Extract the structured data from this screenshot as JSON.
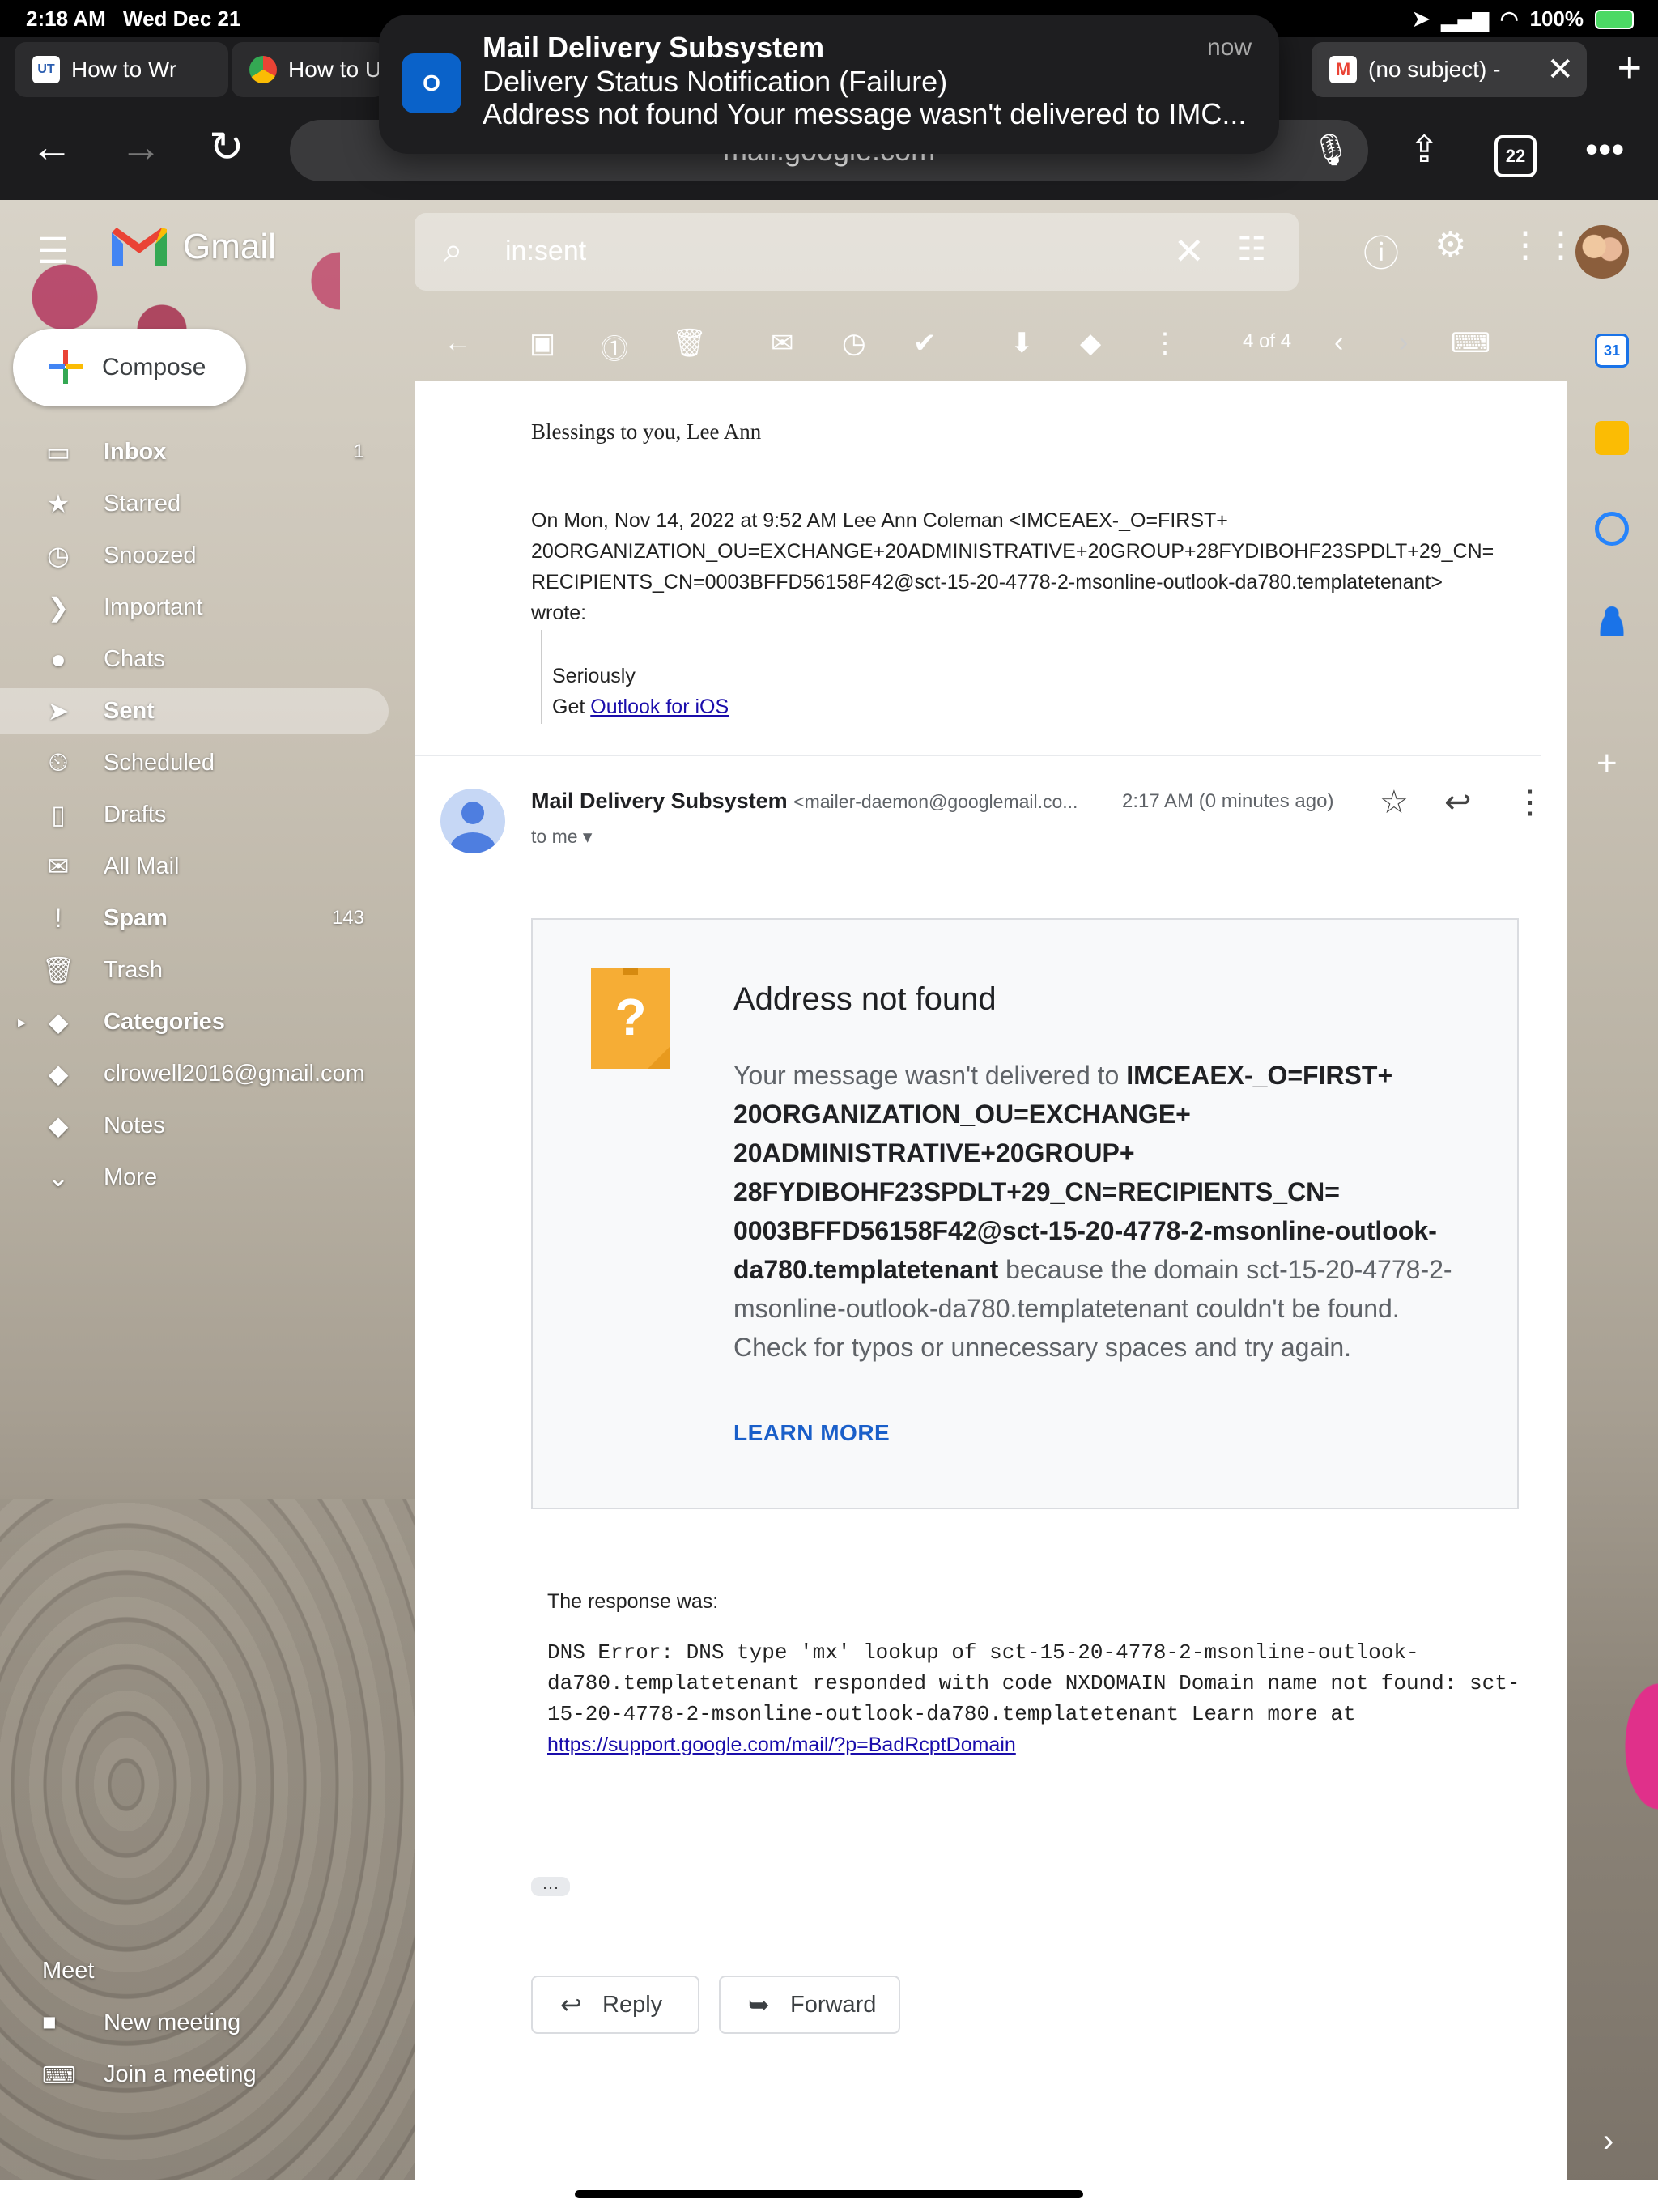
{
  "status_bar": {
    "time": "2:18 AM",
    "date": "Wed Dec 21",
    "battery": "100%"
  },
  "tabs": [
    {
      "label": "How to Wr",
      "favicon": "UT"
    },
    {
      "label": "How to U",
      "favicon": "chrome"
    },
    {
      "label": "(no subject) - ",
      "favicon": "gmail"
    }
  ],
  "toolbar": {
    "url": "mail.google.com",
    "tab_count": "22"
  },
  "notification": {
    "app": "Outlook",
    "title": "Mail Delivery Subsystem",
    "subtitle": "Delivery Status Notification (Failure)",
    "body": "Address not found Your message wasn't delivered to IMC...",
    "when": "now"
  },
  "gmail": {
    "brand": "Gmail",
    "search_query": "in:sent"
  },
  "compose": {
    "label": "Compose"
  },
  "sidebar": {
    "items": [
      {
        "label": "Inbox",
        "icon": "inbox-icon",
        "count": "1",
        "bold": true
      },
      {
        "label": "Starred",
        "icon": "star-icon",
        "count": ""
      },
      {
        "label": "Snoozed",
        "icon": "clock-icon",
        "count": ""
      },
      {
        "label": "Important",
        "icon": "important-icon",
        "count": ""
      },
      {
        "label": "Chats",
        "icon": "chat-icon",
        "count": ""
      },
      {
        "label": "Sent",
        "icon": "send-icon",
        "count": "",
        "bold": true,
        "active": true
      },
      {
        "label": "Scheduled",
        "icon": "scheduled-icon",
        "count": ""
      },
      {
        "label": "Drafts",
        "icon": "draft-icon",
        "count": ""
      },
      {
        "label": "All Mail",
        "icon": "mail-icon",
        "count": ""
      },
      {
        "label": "Spam",
        "icon": "spam-icon",
        "count": "143",
        "bold": true
      },
      {
        "label": "Trash",
        "icon": "trash-icon",
        "count": ""
      },
      {
        "label": "Categories",
        "icon": "label-icon",
        "count": "",
        "bold": true
      },
      {
        "label": "clrowell2016@gmail.com",
        "icon": "label-icon",
        "count": ""
      },
      {
        "label": "Notes",
        "icon": "label-icon",
        "count": ""
      },
      {
        "label": "More",
        "icon": "chevron-down-icon",
        "count": ""
      }
    ],
    "meet": {
      "heading": "Meet",
      "new_meeting": "New meeting",
      "join_meeting": "Join a meeting"
    }
  },
  "action_bar": {
    "pager": "4 of 4"
  },
  "thread": {
    "signoff": "Blessings to you, Lee Ann",
    "quote_header_1": "On Mon, Nov 14, 2022 at 9:52 AM Lee Ann Coleman <IMCEAEX-_O=FIRST+",
    "quote_header_2": "20ORGANIZATION_OU=EXCHANGE+20ADMINISTRATIVE+20GROUP+28FYDIBOHF23SPDLT+29_CN=",
    "quote_header_3": "RECIPIENTS_CN=0003BFFD56158F42@sct-15-20-4778-2-msonline-outlook-da780.templatetenant>",
    "quote_header_4": "wrote:",
    "quoted_line_1": "Seriously",
    "quoted_get": "Get ",
    "quoted_link": "Outlook for iOS"
  },
  "message": {
    "sender_name": "Mail Delivery Subsystem",
    "sender_email": "<mailer-daemon@googlemail.co...",
    "time": "2:17 AM (0 minutes ago)",
    "to": "to me",
    "nf_heading": "Address not found",
    "nf_body_pre": "Your message wasn't delivered to ",
    "nf_body_addr": "IMCEAEX-_O=FIRST+ 20ORGANIZATION_OU=EXCHANGE+ 20ADMINISTRATIVE+20GROUP+ 28FYDIBOHF23SPDLT+29_CN=RECIPIENTS_CN= 0003BFFD56158F42@sct-15-20-4778-2-msonline-outlook-da780.templatetenant",
    "nf_body_post": " because the domain sct-15-20-4778-2-msonline-outlook-da780.templatetenant couldn't be found. Check for typos or unnecessary spaces and try again.",
    "learn_more": "LEARN MORE",
    "response_label": "The response was:",
    "dns_error": "DNS Error: DNS type 'mx' lookup of sct-15-20-4778-2-msonline-outlook-da780.templatetenant responded with code NXDOMAIN Domain name not found: sct-15-20-4778-2-msonline-outlook-da780.templatetenant Learn more at",
    "dns_link": "https://support.google.com/mail/?p=BadRcptDomain",
    "reply": "Reply",
    "forward": "Forward"
  },
  "colors": {
    "accent_blue": "#1a5fc9",
    "active_nav": "rgba(255,255,255,0.35)",
    "calendar": "#1a73e8",
    "keep": "#fbbc04",
    "tasks": "#2684fc",
    "contacts": "#1a73e8"
  }
}
